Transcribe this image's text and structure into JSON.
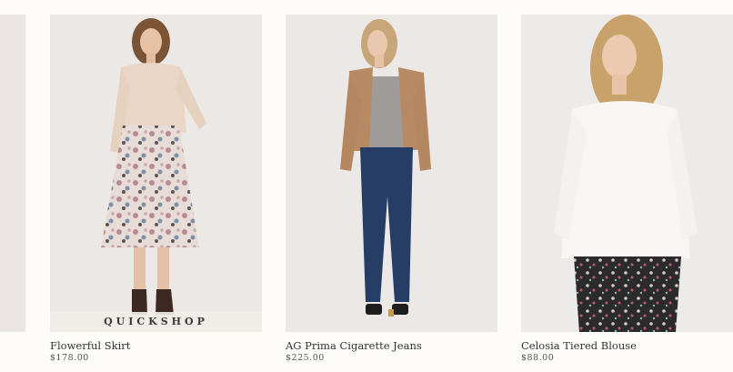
{
  "products": [
    {
      "name": "Flowerful Skirt",
      "price": "$178.00",
      "quickshop_label": "QUICKSHOP"
    },
    {
      "name": "AG Prima Cigarette Jeans",
      "price": "$225.00"
    },
    {
      "name": "Celosia Tiered Blouse",
      "price": "$88.00"
    }
  ],
  "colors": {
    "page_background": "#fdfcf9",
    "photo_background": "#ece9e6",
    "text": "#333333"
  }
}
